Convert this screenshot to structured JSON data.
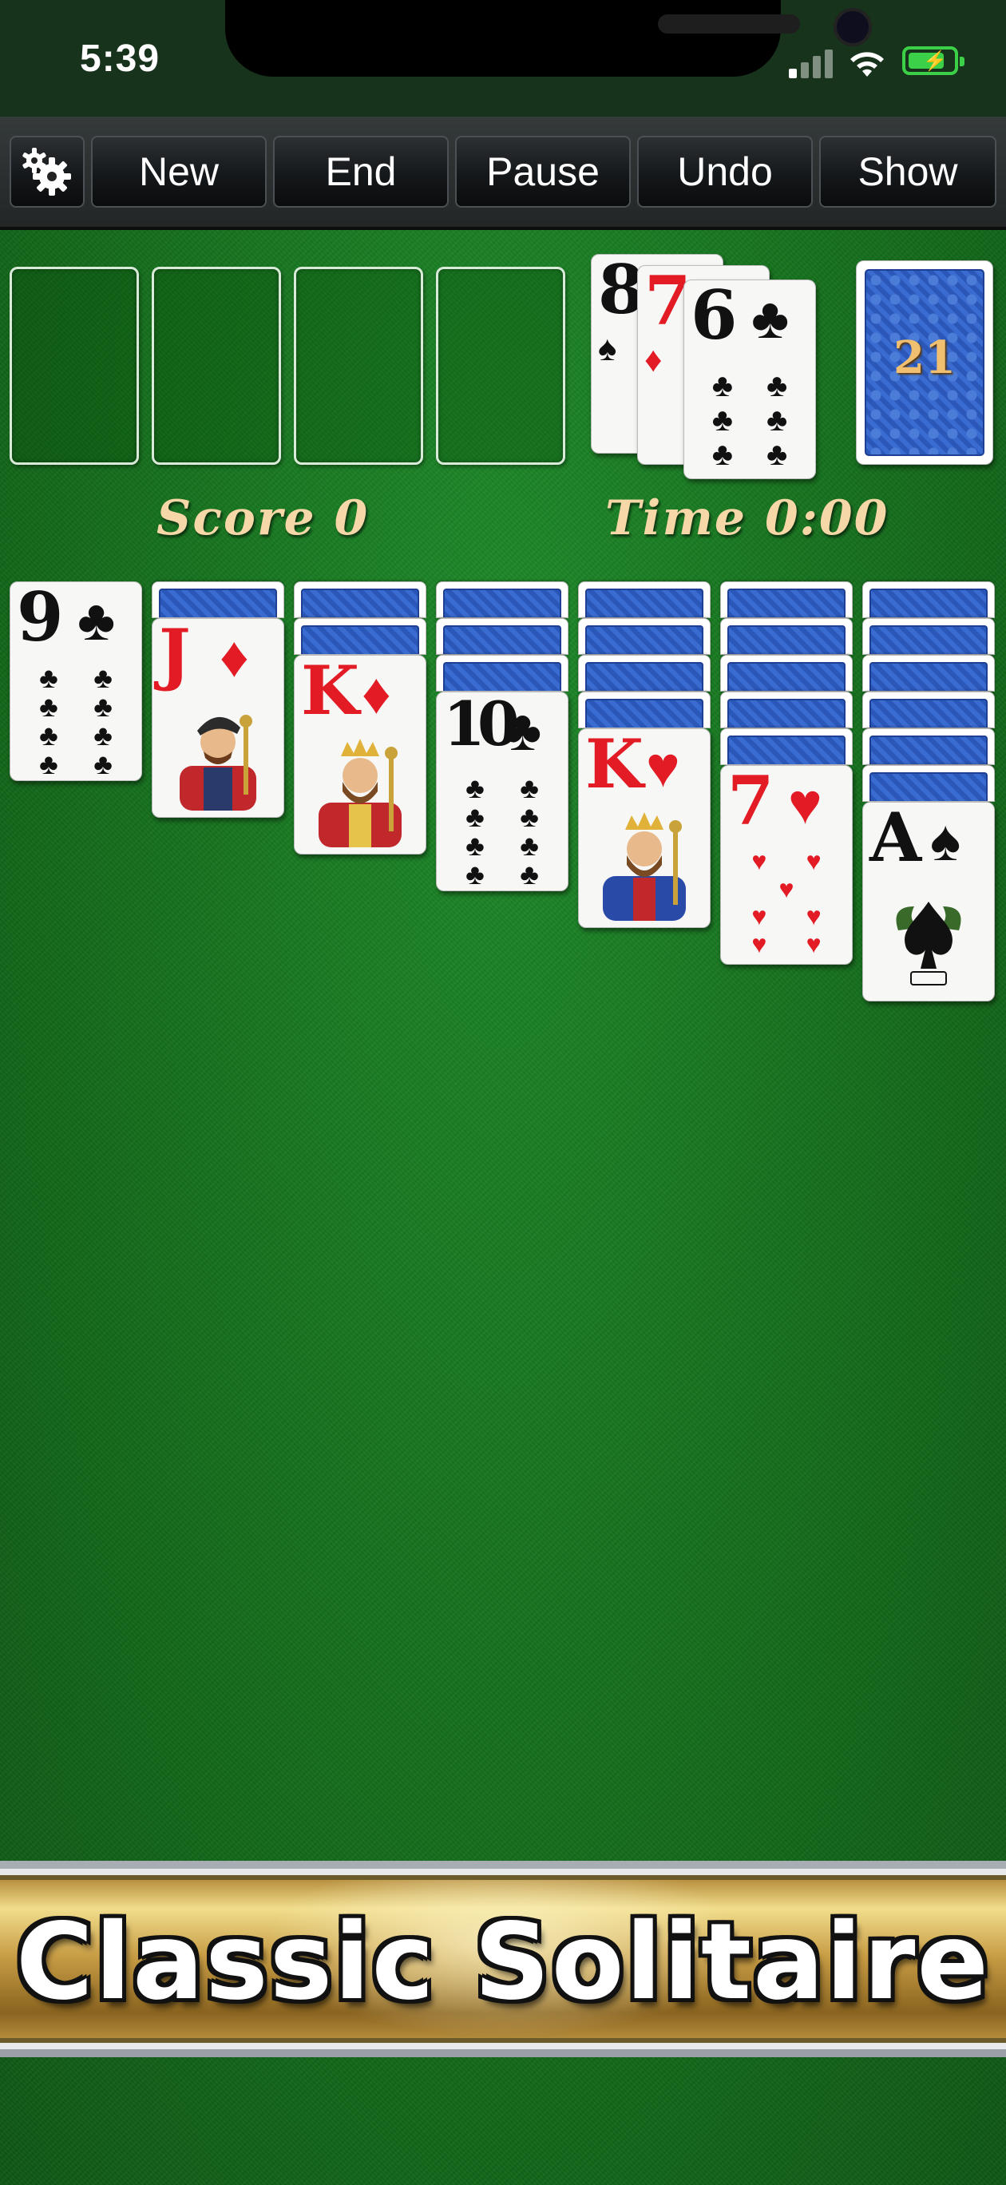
{
  "status": {
    "time": "5:39"
  },
  "toolbar": {
    "new_label": "New",
    "end_label": "End",
    "pause_label": "Pause",
    "undo_label": "Undo",
    "show_label": "Show"
  },
  "game": {
    "score_text": "Score 0",
    "time_text": "Time 0:00",
    "stock_count": "21",
    "waste": [
      {
        "rank": "8",
        "suit": "♠"
      },
      {
        "rank": "7",
        "suit": "♦"
      },
      {
        "rank": "6",
        "suit": "♣"
      }
    ],
    "tableau": [
      {
        "rank": "9",
        "suit": "♣",
        "face_down": 0
      },
      {
        "rank": "J",
        "suit": "♦",
        "face_down": 1
      },
      {
        "rank": "K",
        "suit": "♦",
        "face_down": 2
      },
      {
        "rank": "10",
        "suit": "♣",
        "face_down": 3
      },
      {
        "rank": "K",
        "suit": "♥",
        "face_down": 4
      },
      {
        "rank": "7",
        "suit": "♥",
        "face_down": 5
      },
      {
        "rank": "A",
        "suit": "♠",
        "face_down": 6
      }
    ]
  },
  "banner": {
    "title": "Classic Solitaire"
  },
  "colors": {
    "felt": "#17731f",
    "red_suit": "#e21b25",
    "black_suit": "#111111",
    "score_text": "#f6d7a7"
  },
  "icons": {
    "settings": "gear-icon",
    "wifi": "wifi-icon",
    "battery": "battery-icon",
    "signal": "signal-icon"
  }
}
